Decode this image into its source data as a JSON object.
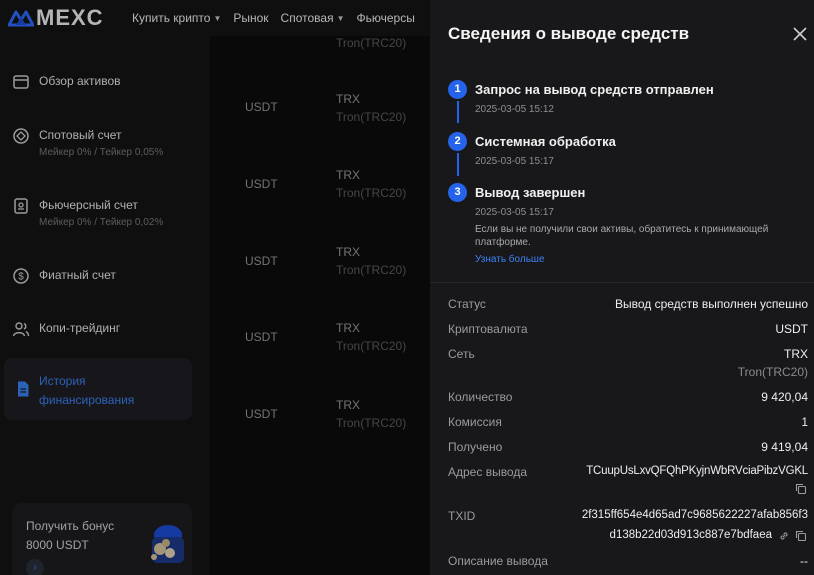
{
  "nav": {
    "logo_text": "MEXC",
    "items": [
      {
        "label": "Купить крипто",
        "has_caret": true
      },
      {
        "label": "Рынок",
        "has_caret": false
      },
      {
        "label": "Спотовая",
        "has_caret": true
      },
      {
        "label": "Фьючерсы",
        "has_caret": false
      }
    ]
  },
  "sidebar": {
    "items": [
      {
        "label": "Обзор активов",
        "sub": ""
      },
      {
        "label": "Спотовый счет",
        "sub": "Мейкер 0% / Тейкер 0,05%"
      },
      {
        "label": "Фьючерсный счет",
        "sub": "Мейкер 0% / Тейкер 0,02%"
      },
      {
        "label": "Фиатный счет",
        "sub": ""
      },
      {
        "label": "Копи-трейдинг",
        "sub": ""
      }
    ],
    "active_label": "История финансирования",
    "bonus": {
      "line1": "Получить бонус",
      "line2": "8000 USDT"
    }
  },
  "table": {
    "top_partial": "Tron(TRC20)",
    "rows": [
      {
        "asset": "USDT",
        "network": "TRX",
        "network_full": "Tron(TRC20)"
      },
      {
        "asset": "USDT",
        "network": "TRX",
        "network_full": "Tron(TRC20)"
      },
      {
        "asset": "USDT",
        "network": "TRX",
        "network_full": "Tron(TRC20)"
      },
      {
        "asset": "USDT",
        "network": "TRX",
        "network_full": "Tron(TRC20)"
      },
      {
        "asset": "USDT",
        "network": "TRX",
        "network_full": "Tron(TRC20)"
      }
    ]
  },
  "drawer": {
    "title": "Сведения о выводе средств",
    "steps": [
      {
        "num": "1",
        "title": "Запрос на вывод средств отправлен",
        "time": "2025-03-05 15:12"
      },
      {
        "num": "2",
        "title": "Системная обработка",
        "time": "2025-03-05 15:17"
      },
      {
        "num": "3",
        "title": "Вывод завершен",
        "time": "2025-03-05 15:17"
      }
    ],
    "note": "Если вы не получили свои активы, обратитесь к принимающей платформе.",
    "learn_more": "Узнать больше",
    "details": {
      "status_label": "Статус",
      "status_value": "Вывод средств выполнен успешно",
      "crypto_label": "Криптовалюта",
      "crypto_value": "USDT",
      "network_label": "Сеть",
      "network_value": "TRX",
      "network_sub": "Tron(TRC20)",
      "amount_label": "Количество",
      "amount_value": "9 420,04",
      "fee_label": "Комиссия",
      "fee_value": "1",
      "received_label": "Получено",
      "received_value": "9 419,04",
      "address_label": "Адрес вывода",
      "address_value": "TCuupUsLxvQFQhPKyjnWbRVciaPibzVGKL",
      "txid_label": "TXID",
      "txid_line1": "2f315ff654e4d65ad7c9685622227afab856f3",
      "txid_line2": "d138b22d03d913c887e7bdfaea",
      "desc_label": "Описание вывода",
      "desc_value": "--"
    }
  },
  "colors": {
    "accent": "#2563eb",
    "link": "#3b82f6",
    "bg": "#0b0b0d",
    "panel": "#18181b"
  }
}
